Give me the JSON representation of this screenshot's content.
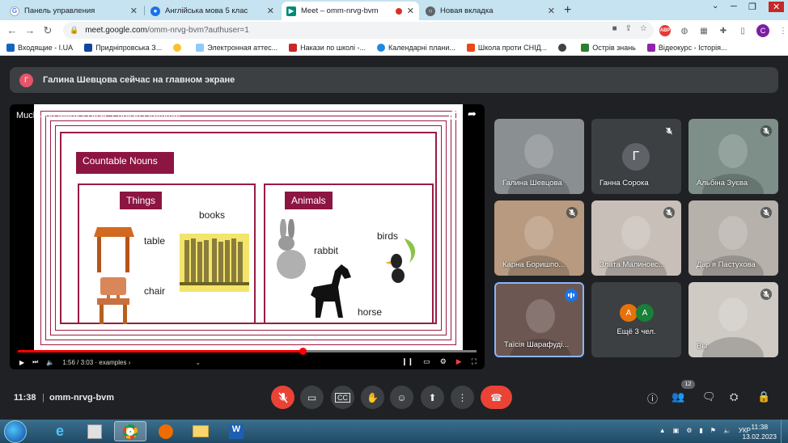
{
  "browser": {
    "tabs": [
      {
        "label": "Панель управления",
        "favicon": "google-icon",
        "color": "#4285f4"
      },
      {
        "label": "Англійська мова 5 клас",
        "favicon": "person-icon",
        "color": "#1a73e8"
      },
      {
        "label": "Meet – omm-nrvg-bvm",
        "favicon": "meet-icon",
        "color": "#00897b"
      },
      {
        "label": "Новая вкладка",
        "favicon": "chrome-icon",
        "color": "#5f6368"
      }
    ],
    "url_host": "meet.google.com",
    "url_path": "/omm-nrvg-bvm?authuser=1",
    "profile_letter": "C",
    "abp_label": "ABP",
    "bookmarks": [
      {
        "label": "Входящие - I.UA",
        "color": "#1565c0"
      },
      {
        "label": "Придніпровська З...",
        "color": "#0d47a1"
      },
      {
        "label": "Электронная аттес...",
        "color": "#90caf9"
      },
      {
        "label": "Накази по школі -...",
        "color": "#c62828"
      },
      {
        "label": "Календарні плани...",
        "color": "#1e88e5"
      },
      {
        "label": "Школа проти СНІД...",
        "color": "#e64a19"
      },
      {
        "label": "Острів знань",
        "color": "#2e7d32"
      },
      {
        "label": "Відеокурс - Історія...",
        "color": "#8e24aa"
      }
    ]
  },
  "meet": {
    "banner_avatar": "Г",
    "banner_text": "Галина Шевцова сейчас на главном экране",
    "video": {
      "title": "Much and Many - Basic English Grammar",
      "time": "1:56 / 3:03 · examples ›",
      "progress": 0.62
    },
    "slide": {
      "header": "Countable Nouns",
      "things_label": "Things",
      "animals_label": "Animals",
      "words": {
        "table": "table",
        "books": "books",
        "chair": "chair",
        "rabbit": "rabbit",
        "birds": "birds",
        "horse": "horse"
      }
    },
    "participants": [
      {
        "name": "Галина Шевцова",
        "muted": false,
        "bg": "#8a8f92"
      },
      {
        "name": "Ганна Сорока",
        "muted": true,
        "avatar": "Г",
        "bg": "#3c4043"
      },
      {
        "name": "Альбіна Зуєва",
        "muted": true,
        "bg": "#7d8f88"
      },
      {
        "name": "Карна Боришпо...",
        "muted": true,
        "bg": "#b79a7f"
      },
      {
        "name": "Злата Малиновс...",
        "muted": true,
        "bg": "#c8bfb8"
      },
      {
        "name": "Дар'я Пастухова",
        "muted": true,
        "bg": "#b7b1ab"
      },
      {
        "name": "Таїсія Шарафуді...",
        "muted": false,
        "speaking": true,
        "bg": "#6d5752"
      },
      {
        "name": "Ещё 3 чел.",
        "more": true,
        "avatars": [
          "А",
          "А"
        ],
        "bg": "#3c4043"
      },
      {
        "name": "Вы",
        "muted": true,
        "bg": "#cfcac4"
      }
    ],
    "clock": "11:38",
    "separator": "|",
    "meeting_code": "omm-nrvg-bvm",
    "people_count": "12"
  },
  "taskbar": {
    "lang": "УКР",
    "time": "11:38",
    "date": "13.02.2023"
  }
}
